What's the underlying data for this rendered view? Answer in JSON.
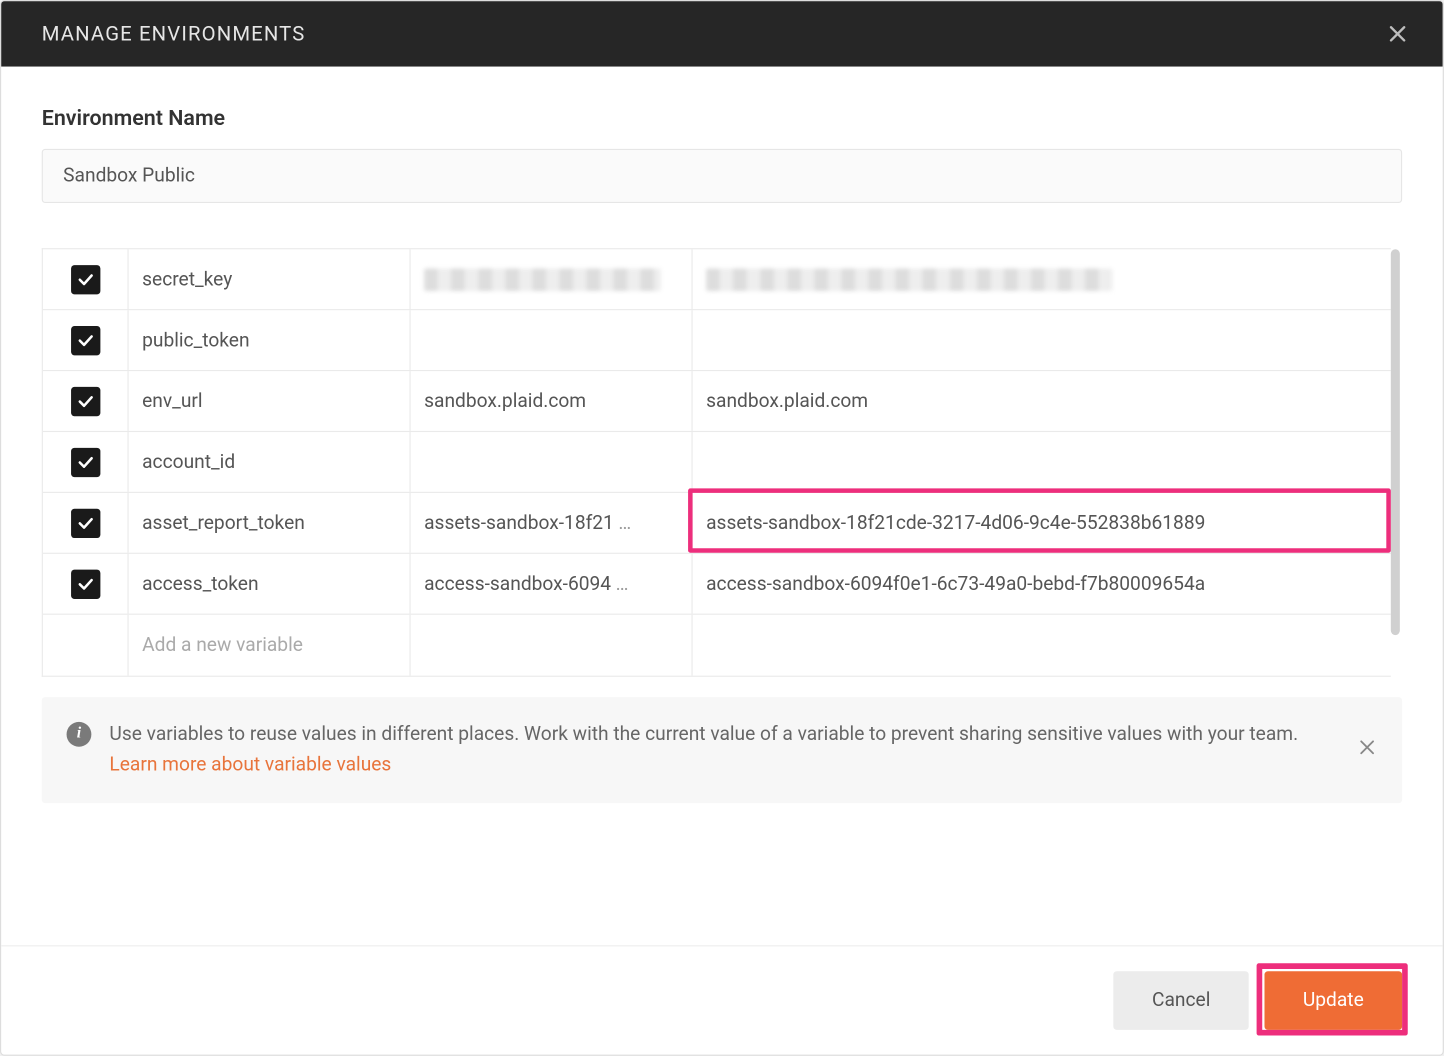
{
  "titlebar": {
    "title": "MANAGE ENVIRONMENTS"
  },
  "form": {
    "env_name_label": "Environment Name",
    "env_name_value": "Sandbox Public"
  },
  "variables": [
    {
      "enabled": true,
      "name": "secret_key",
      "initial_redacted": true,
      "current_redacted": true,
      "initial": "",
      "current": ""
    },
    {
      "enabled": true,
      "name": "public_token",
      "initial": "",
      "current": ""
    },
    {
      "enabled": true,
      "name": "env_url",
      "initial": "sandbox.plaid.com",
      "current": "sandbox.plaid.com"
    },
    {
      "enabled": true,
      "name": "account_id",
      "initial": "",
      "current": ""
    },
    {
      "enabled": true,
      "name": "asset_report_token",
      "initial": "assets-sandbox-18f21",
      "initial_truncated": true,
      "current": "assets-sandbox-18f21cde-3217-4d06-9c4e-552838b61889"
    },
    {
      "enabled": true,
      "name": "access_token",
      "initial": "access-sandbox-6094",
      "initial_truncated": true,
      "current": "access-sandbox-6094f0e1-6c73-49a0-bebd-f7b80009654a"
    }
  ],
  "new_variable_placeholder": "Add a new variable",
  "info": {
    "text": "Use variables to reuse values in different places. Work with the current value of a variable to prevent sharing sensitive values with your team. ",
    "link": "Learn more about variable values"
  },
  "footer": {
    "cancel": "Cancel",
    "update": "Update"
  }
}
